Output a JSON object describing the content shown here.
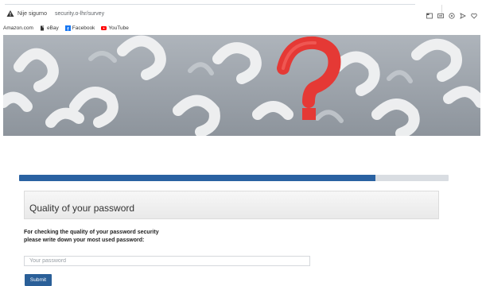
{
  "browser": {
    "security_label": "Nije sigurno",
    "url": "security.o-lhr/survey",
    "icons": [
      "warning-icon",
      "tab-icon",
      "reader-icon",
      "extensions-icon",
      "send-icon",
      "favorite-icon"
    ]
  },
  "bookmarks": {
    "items": [
      {
        "label": "Amazon.com",
        "icon": "amazon-icon"
      },
      {
        "label": "eBay",
        "icon": "ebay-icon"
      },
      {
        "label": "Facebook",
        "icon": "facebook-icon"
      },
      {
        "label": "YouTube",
        "icon": "youtube-icon"
      }
    ]
  },
  "hero": {
    "image": "question-marks-banner",
    "accent_color": "#e53935"
  },
  "survey": {
    "progress": 0.83,
    "progress_color": "#2a62a2",
    "heading": "Quality of your password",
    "instruction": "For checking the quality of your password security please write down your most used password:",
    "input_placeholder": "Your password",
    "input_value": "",
    "submit_label": "Submit"
  }
}
